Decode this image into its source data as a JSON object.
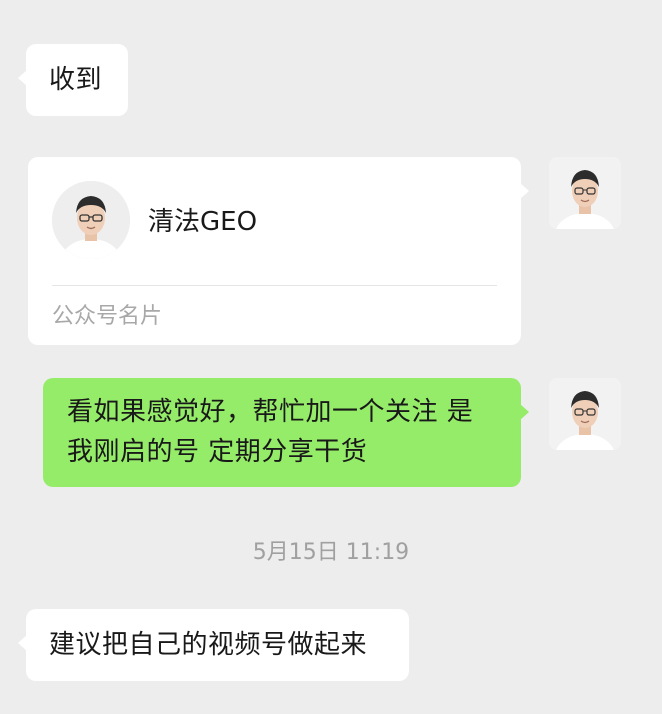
{
  "messages": {
    "received_1": "收到",
    "contact_card": {
      "name": "清法GEO",
      "label": "公众号名片"
    },
    "sent_text": "看如果感觉好，帮忙加一个关注 是我刚启的号 定期分享干货",
    "timestamp": "5月15日 11:19",
    "received_2": "建议把自己的视频号做起来"
  },
  "colors": {
    "background": "#ededed",
    "incoming_bubble": "#ffffff",
    "outgoing_bubble": "#95ec69",
    "meta_text": "#a0a0a0"
  },
  "icons": {
    "avatar": "person-avatar-icon"
  }
}
